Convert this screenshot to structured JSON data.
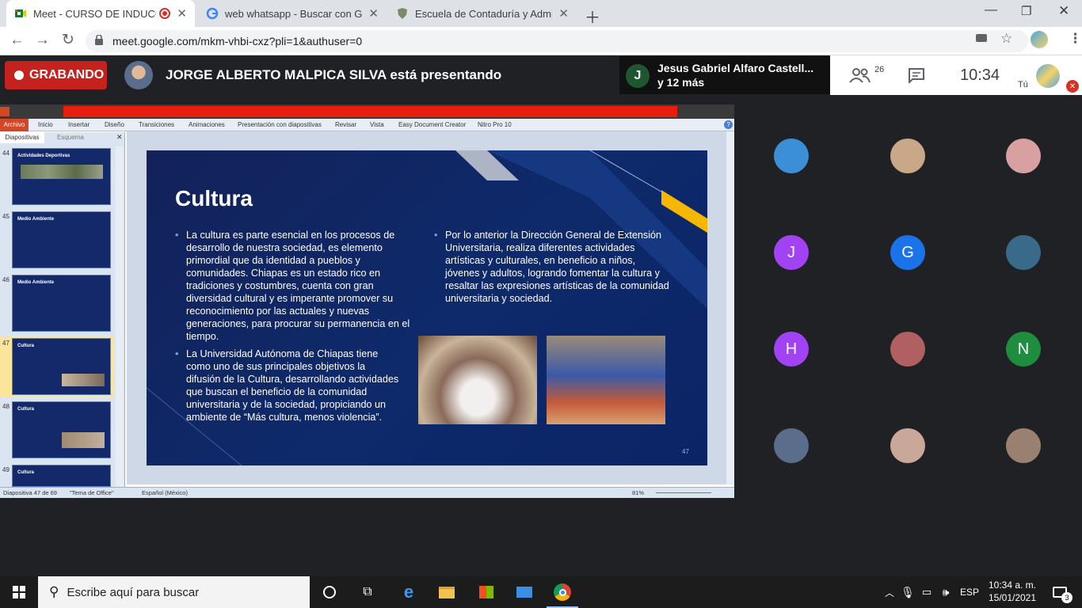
{
  "browser": {
    "tabs": [
      {
        "title": "Meet - CURSO DE INDUCCIÓ"
      },
      {
        "title": "web whatsapp - Buscar con Goo"
      },
      {
        "title": "Escuela de Contaduría y Adminis"
      }
    ],
    "url": "meet.google.com/mkm-vhbi-cxz?pli=1&authuser=0"
  },
  "meet": {
    "recording_label": "GRABANDO",
    "presenting_text": "JORGE ALBERTO MALPICA SILVA está presentando",
    "chat_author": "Jesus Gabriel Alfaro Castell...",
    "chat_more": "y 12 más",
    "chat_avatar_letter": "J",
    "participants_count": "26",
    "time": "10:34",
    "self_label": "Tú",
    "participants": [
      {
        "letter": "",
        "color": "#3b8fd6"
      },
      {
        "letter": "",
        "color": "#c9a88a"
      },
      {
        "letter": "",
        "color": "#d8a0a0"
      },
      {
        "letter": "J",
        "color": "#a142f4"
      },
      {
        "letter": "G",
        "color": "#1a73e8"
      },
      {
        "letter": "",
        "color": "#3a6a8a"
      },
      {
        "letter": "H",
        "color": "#a142f4"
      },
      {
        "letter": "",
        "color": "#b06060"
      },
      {
        "letter": "N",
        "color": "#1e8e3e"
      },
      {
        "letter": "",
        "color": "#5a6d8a"
      },
      {
        "letter": "",
        "color": "#c9a89a"
      },
      {
        "letter": "",
        "color": "#9a8070"
      }
    ]
  },
  "powerpoint": {
    "ribbon_tabs": [
      "Archivo",
      "Inicio",
      "Insertar",
      "Diseño",
      "Transiciones",
      "Animaciones",
      "Presentación con diapositivas",
      "Revisar",
      "Vista",
      "Easy Document Creator",
      "Nitro Pro 10"
    ],
    "panel_tabs": [
      "Diapositivas",
      "Esquema"
    ],
    "thumbnails": [
      {
        "number": "44",
        "title": "Actividades Deportivas"
      },
      {
        "number": "45",
        "title": "Medio Ambiente"
      },
      {
        "number": "46",
        "title": "Medio Ambiente"
      },
      {
        "number": "47",
        "title": "Cultura"
      },
      {
        "number": "48",
        "title": "Cultura"
      },
      {
        "number": "49",
        "title": "Cultura"
      }
    ],
    "status": {
      "slide": "Diapositiva 47 de 69",
      "theme": "\"Tema de Office\"",
      "language": "Español (México)",
      "zoom": "81%"
    }
  },
  "slide": {
    "title": "Cultura",
    "bullet1": "La cultura es parte esencial en los procesos de desarrollo de nuestra sociedad, es elemento primordial que da identidad a pueblos y comunidades. Chiapas es un estado rico en tradiciones y costumbres, cuenta con gran diversidad cultural y es imperante promover su reconocimiento por las actuales y nuevas generaciones, para procurar su permanencia en el tiempo.",
    "bullet2": "La Universidad Autónoma de Chiapas tiene como uno de sus principales objetivos la difusión de la Cultura, desarrollando actividades que buscan el beneficio de la comunidad universitaria y de la sociedad, propiciando un ambiente de “Más cultura, menos violencia”.",
    "bullet3": "Por lo anterior la Dirección General de Extensión Universitaria, realiza diferentes actividades artísticas y culturales, en beneficio a niños, jóvenes y adultos, logrando fomentar la cultura y resaltar las expresiones artísticas de la comunidad universitaria y sociedad.",
    "page_number": "47"
  },
  "taskbar": {
    "search_placeholder": "Escribe aquí para buscar",
    "language": "ESP",
    "time": "10:34 a. m.",
    "date": "15/01/2021",
    "notifications": "3"
  }
}
